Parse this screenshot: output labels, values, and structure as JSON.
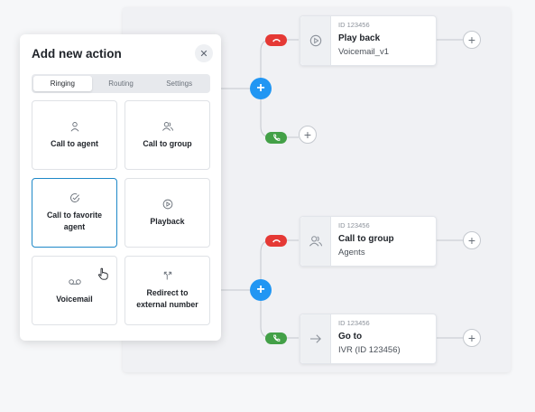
{
  "panel": {
    "title": "Add new action",
    "tabs": [
      {
        "label": "Ringing",
        "active": true
      },
      {
        "label": "Routing",
        "active": false
      },
      {
        "label": "Settings",
        "active": false
      }
    ],
    "cards": [
      {
        "label": "Call to agent",
        "icon": "person-icon"
      },
      {
        "label": "Call to group",
        "icon": "group-icon"
      },
      {
        "label": "Call to favorite agent",
        "icon": "check-circle-icon",
        "selected": true
      },
      {
        "label": "Playback",
        "icon": "play-circle-icon"
      },
      {
        "label": "Voicemail",
        "icon": "voicemail-icon"
      },
      {
        "label": "Redirect to external number",
        "icon": "redirect-icon"
      }
    ]
  },
  "flow": {
    "nodes": [
      {
        "id": "ID 123456",
        "title": "Play back",
        "subtitle": "Voicemail_v1",
        "icon": "play-circle-icon"
      },
      {
        "id": "ID 123456",
        "title": "Call to group",
        "subtitle": "Agents",
        "icon": "group-icon"
      },
      {
        "id": "ID 123456",
        "title": "Go to",
        "subtitle": "IVR (ID 123456)",
        "icon": "arrow-right-icon"
      }
    ]
  },
  "colors": {
    "accent": "#2196f3",
    "hangup": "#e53935",
    "answer": "#43a047",
    "selected_border": "#1e88c8"
  }
}
